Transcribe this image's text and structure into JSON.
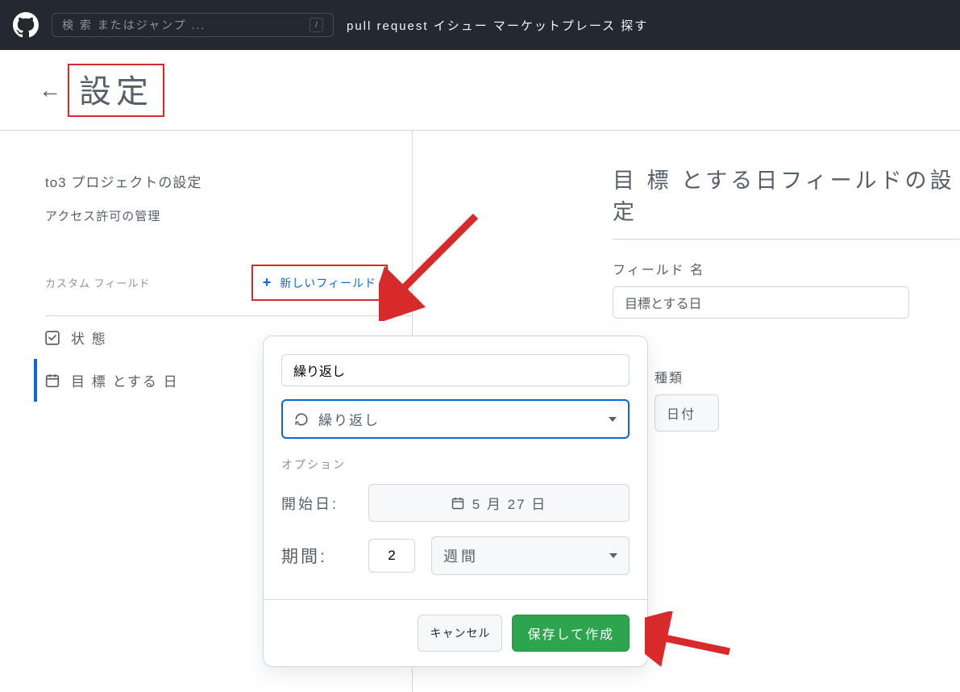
{
  "topbar": {
    "search_placeholder": "検 索 またはジャンプ ...",
    "slash": "/",
    "nav": "pull  request イシュー マーケットプレース 探す"
  },
  "header": {
    "title": "設定"
  },
  "sidebar": {
    "item_project": "to3 プロジェクトの設定",
    "item_access": "アクセス許可の管理",
    "cf_label": "カスタム フィールド",
    "new_field": "新しいフィールド",
    "field_status": "状 態",
    "field_target_date": "目 標 とする 日"
  },
  "right": {
    "title": "目 標 とする日フィールドの設定",
    "fieldname_label": "フィールド 名",
    "fieldname_value": "目標とする日",
    "type_label": "種類",
    "type_value": "日付"
  },
  "popover": {
    "name_value": "繰り返し",
    "type_value": "繰り返し",
    "options_label": "オプション",
    "start_label": "開始日:",
    "start_value": "5 月 27 日",
    "duration_label": "期間:",
    "duration_value": "2",
    "duration_unit": "週間",
    "cancel": "キャンセル",
    "save": "保存して作成"
  }
}
